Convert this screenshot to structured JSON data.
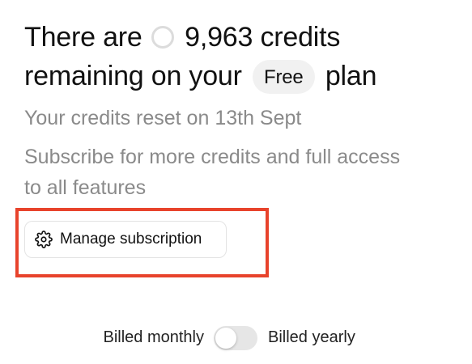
{
  "credits": {
    "headline_prefix": "There are",
    "count": "9,963",
    "headline_mid": "credits remaining on your",
    "plan_name": "Free",
    "headline_suffix": "plan",
    "ring_icon": "loading-ring-icon",
    "reset_text": "Your credits reset on 13th Sept",
    "subscribe_text": "Subscribe for more credits and full access to all features"
  },
  "manage": {
    "label": "Manage subscription",
    "icon": "gear-icon",
    "highlight_color": "#e8432c"
  },
  "billing": {
    "monthly_label": "Billed monthly",
    "yearly_label": "Billed yearly",
    "toggle_on": false
  }
}
